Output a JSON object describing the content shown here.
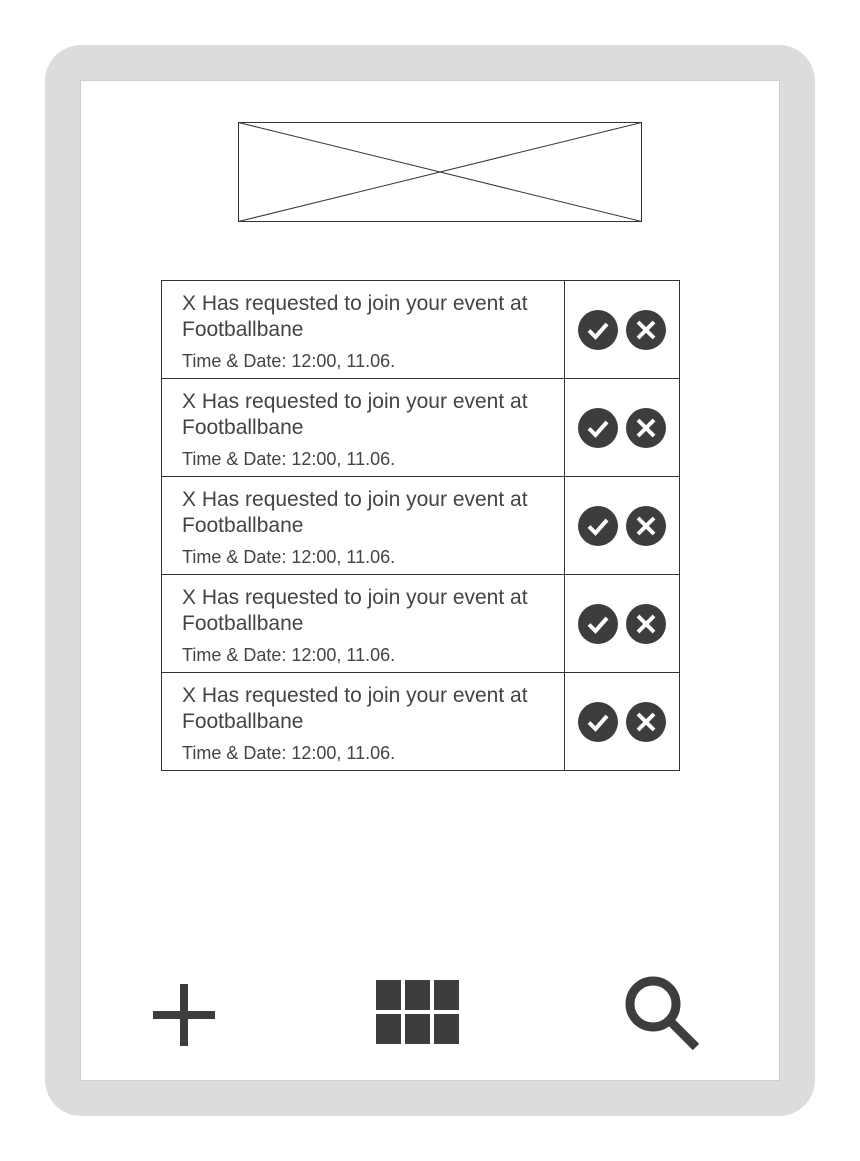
{
  "requests": [
    {
      "title": "X Has requested to join your event at Footballbane",
      "time": "Time & Date: 12:00, 11.06."
    },
    {
      "title": "X Has requested to join your event at Footballbane",
      "time": "Time & Date: 12:00, 11.06."
    },
    {
      "title": "X Has requested to join your event at Footballbane",
      "time": "Time & Date: 12:00, 11.06."
    },
    {
      "title": "X Has requested to join your event at Footballbane",
      "time": "Time & Date: 12:00, 11.06."
    },
    {
      "title": "X Has requested to join your event at Footballbane",
      "time": "Time & Date: 12:00, 11.06."
    }
  ],
  "icons": {
    "accept": "check-icon",
    "decline": "close-icon",
    "add": "plus-icon",
    "grid": "grid-icon",
    "search": "search-icon"
  },
  "colors": {
    "device_frame": "#dcdcdc",
    "icon_fill": "#3d3d3d",
    "text": "#444444",
    "border": "#333333"
  }
}
